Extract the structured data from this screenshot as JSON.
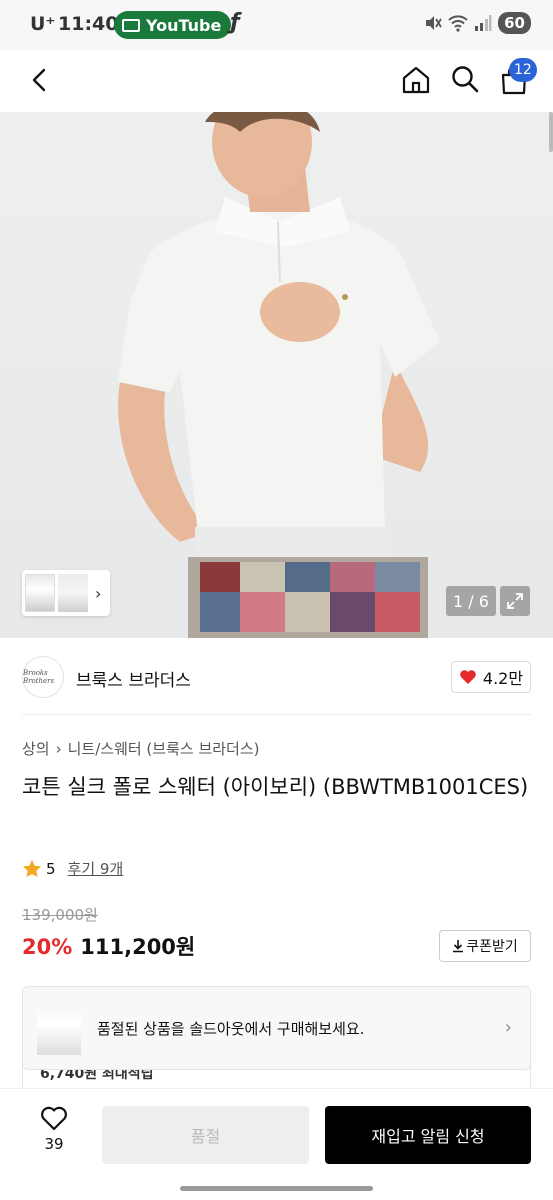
{
  "status_bar": {
    "carrier": "U⁺",
    "time": "11:40",
    "app_pill": "YouTube",
    "battery": "60"
  },
  "header": {
    "cart_count": "12"
  },
  "gallery": {
    "counter": "1 / 6"
  },
  "brand": {
    "logo_text": "Brooks Brothers",
    "name": "브룩스 브라더스",
    "likes": "4.2만"
  },
  "breadcrumb": [
    "상의",
    "니트/스웨터 (브룩스 브라더스)"
  ],
  "product": {
    "title": "코튼 실크 폴로 스웨터 (아이보리) (BBWTMB1001CES)",
    "rating": "5",
    "review_label": "후기 9개",
    "original_price": "139,000원",
    "discount": "20%",
    "price": "111,200원",
    "coupon_label": "쿠폰받기"
  },
  "banner": {
    "text": "품절된 상품을 솔드아웃에서 구매해보세요."
  },
  "peek": {
    "text": "6,740원 최대적립"
  },
  "bottom": {
    "wish_count": "39",
    "soldout_label": "품절",
    "notify_label": "재입고 알림 신청"
  },
  "colors": {
    "accent_red": "#e52b2b",
    "badge_blue": "#2b63d9",
    "yt_green": "#1a7a3c"
  }
}
